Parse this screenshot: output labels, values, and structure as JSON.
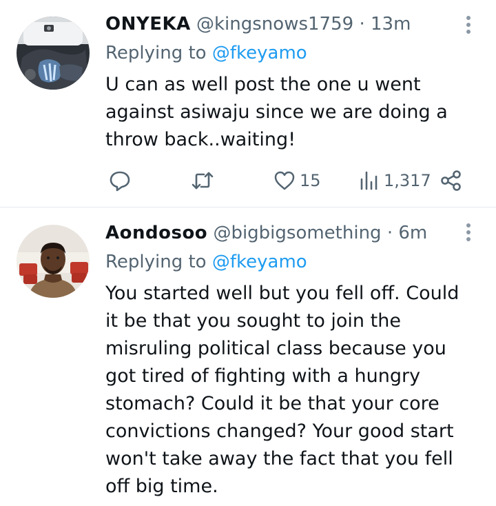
{
  "tweets": [
    {
      "display_name": "ONYEKA",
      "handle": "@kingsnows1759",
      "separator": "·",
      "time": "13m",
      "replying_prefix": "Replying to",
      "replying_to": "@fkeyamo",
      "text": "U can as well post the one u went\nagainst asiwaju since we are doing a\nthrow back..waiting!",
      "actions": {
        "likes": "15",
        "views": "1,317"
      }
    },
    {
      "display_name": "Aondosoo",
      "handle": "@bigbigsomething",
      "separator": "·",
      "time": "6m",
      "replying_prefix": "Replying to",
      "replying_to": "@fkeyamo",
      "text": "You started well but you fell off. Could\nit be that you sought to join the\nmisruling political class because you\ngot tired of fighting with a hungry\nstomach? Could it be that your core\nconvictions changed? Your good start\nwon't take away the fact that you fell\noff big time."
    }
  ],
  "icons": {
    "reply": "speech-bubble-icon",
    "retweet": "retweet-arrows-icon",
    "like": "heart-icon",
    "views": "bar-chart-icon",
    "share": "share-nodes-icon",
    "more": "vertical-dots-icon"
  },
  "colors": {
    "text": "#0f1419",
    "secondary": "#536471",
    "link": "#1d9bf0",
    "divider": "#e6ecf0"
  }
}
